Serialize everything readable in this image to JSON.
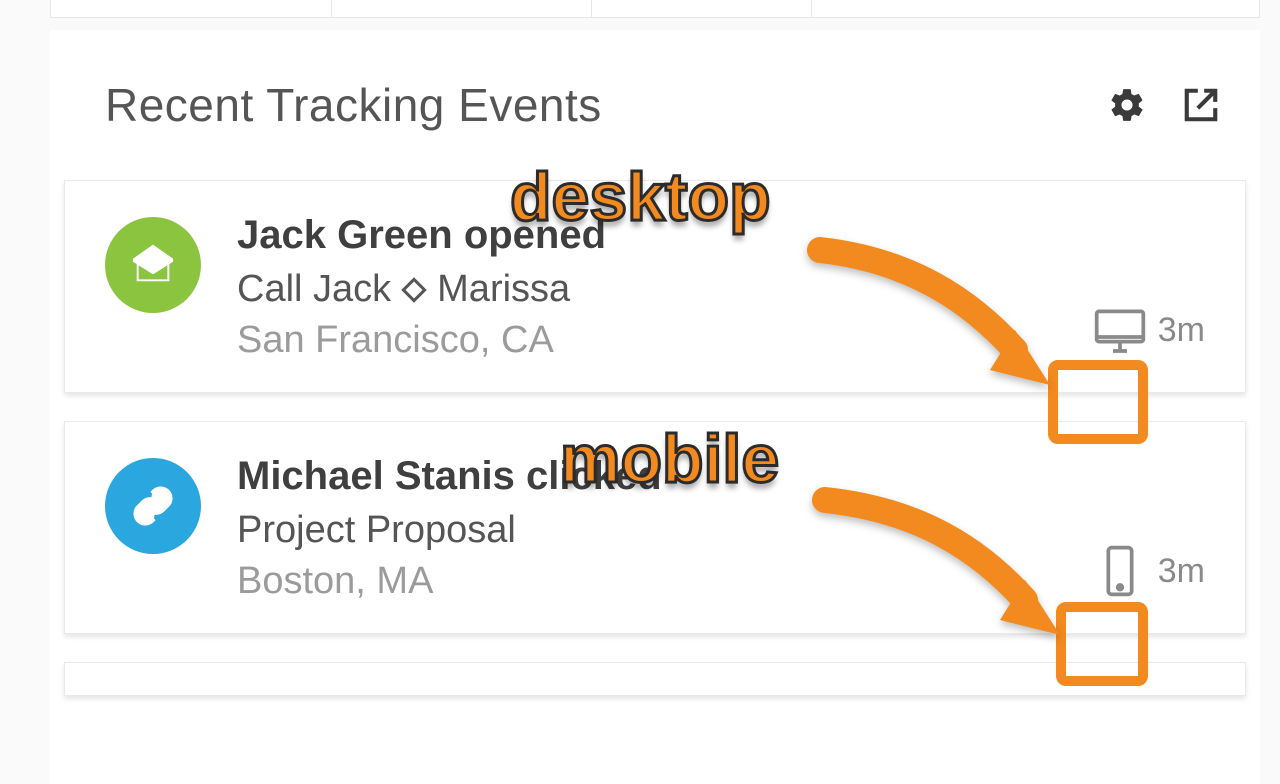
{
  "header": {
    "title": "Recent Tracking Events",
    "icons": {
      "settings": "gear",
      "open": "open-external"
    }
  },
  "events": [
    {
      "kind": "opened",
      "avatar_color": "green",
      "title": "Jack Green opened",
      "subject_pre": "Call Jack",
      "subject_post": "Marissa",
      "location": "San Francisco, CA",
      "device": "desktop",
      "time": "3m"
    },
    {
      "kind": "clicked",
      "avatar_color": "blue",
      "title": "Michael Stanis clicked",
      "subject_pre": "Project Proposal",
      "subject_post": "",
      "location": "Boston, MA",
      "device": "mobile",
      "time": "3m"
    }
  ],
  "annotations": {
    "desktop_label": "desktop",
    "mobile_label": "mobile"
  }
}
